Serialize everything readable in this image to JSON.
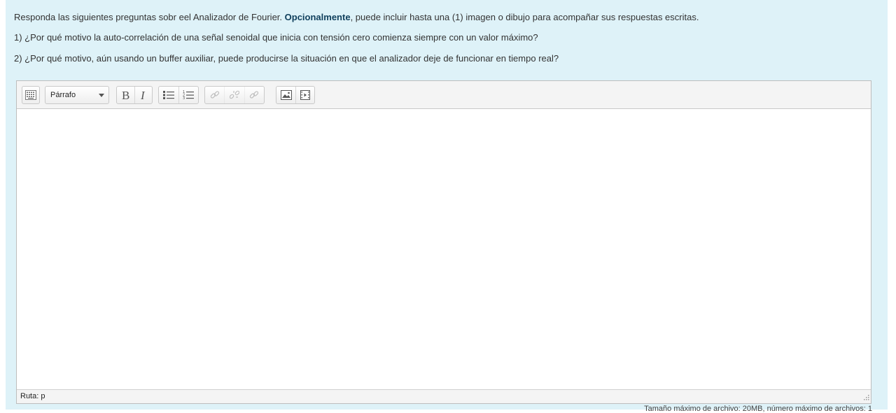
{
  "question": {
    "intro_before": "Responda las siguientes preguntas sobr eel Analizador de Fourier. ",
    "intro_bold": "Opcionalmente",
    "intro_after": ", puede incluir hasta una (1) imagen o dibujo para acompañar sus respuestas escritas.",
    "q1": "1) ¿Por qué motivo la auto-correlación de una señal senoidal que inicia con tensión cero comienza siempre con un valor máximo?",
    "q2": "2) ¿Por qué motivo, aún usando un buffer auxiliar, puede producirse la situación en que el analizador deje de funcionar en tiempo real?"
  },
  "editor": {
    "format_value": "Párrafo",
    "path_text": "Ruta: p",
    "body_text": ""
  },
  "toolbar": {
    "icons": [
      "toggle-toolbar-icon",
      "bold-icon",
      "italic-icon",
      "unordered-list-icon",
      "ordered-list-icon",
      "link-icon",
      "unlink-icon",
      "anchor-icon",
      "image-icon",
      "media-icon"
    ]
  },
  "footer": {
    "note": "Tamaño máximo de archivo: 20MB, número máximo de archivos: 1"
  },
  "colors": {
    "panel_bg": "#def2f8",
    "bold_text": "#0f3f5c"
  }
}
